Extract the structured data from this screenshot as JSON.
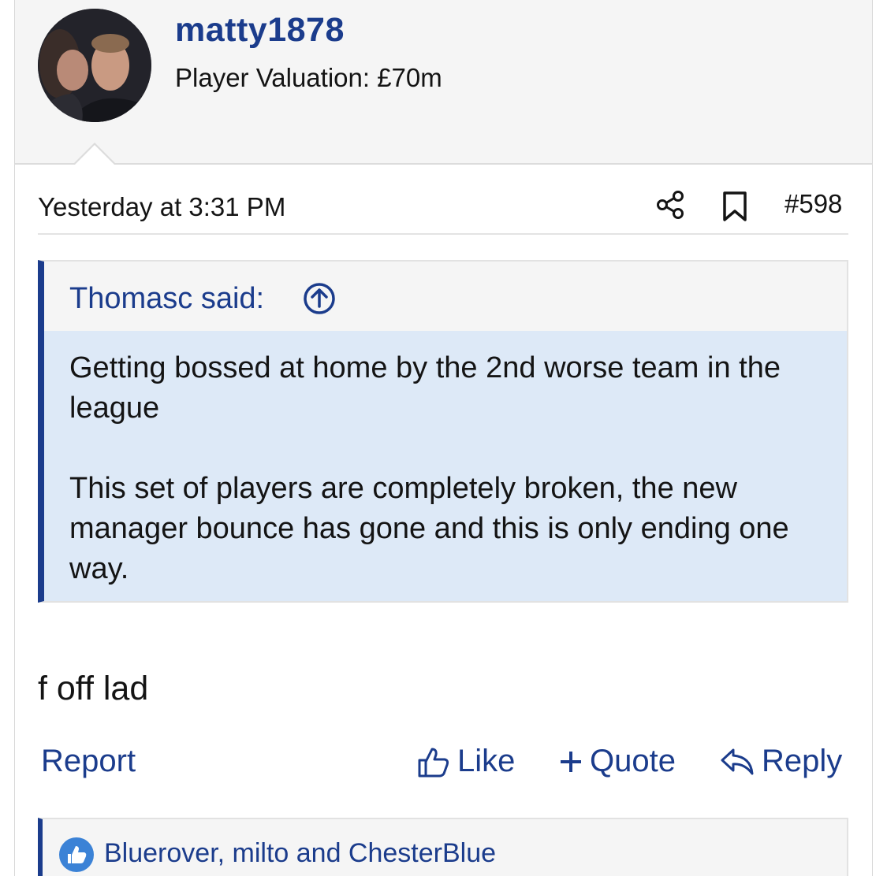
{
  "post": {
    "username": "matty1878",
    "valuation": "Player Valuation: £70m",
    "timestamp": "Yesterday at 3:31 PM",
    "post_number": "#598",
    "quote": {
      "author": "Thomasc said:",
      "paragraphs": [
        "Getting bossed at home by the 2nd worse team in the league",
        "This set of players are completely broken, the new manager bounce has gone and this is only ending one way."
      ]
    },
    "message": "f off lad",
    "actions": {
      "report": "Report",
      "like": "Like",
      "quote": "Quote",
      "reply": "Reply"
    },
    "reactions": {
      "users": "Bluerover, milto and ChesterBlue"
    }
  },
  "icons": {
    "share": "share-icon",
    "bookmark": "bookmark-icon",
    "quote_jump": "arrow-up-circle-icon",
    "like": "thumbs-up-icon",
    "quote_plus": "plus-icon",
    "reply": "reply-icon",
    "reaction": "like-reaction-icon"
  },
  "colors": {
    "accent": "#1b3c8c",
    "quote_background": "#dde9f7",
    "header_background": "#f5f5f5"
  }
}
